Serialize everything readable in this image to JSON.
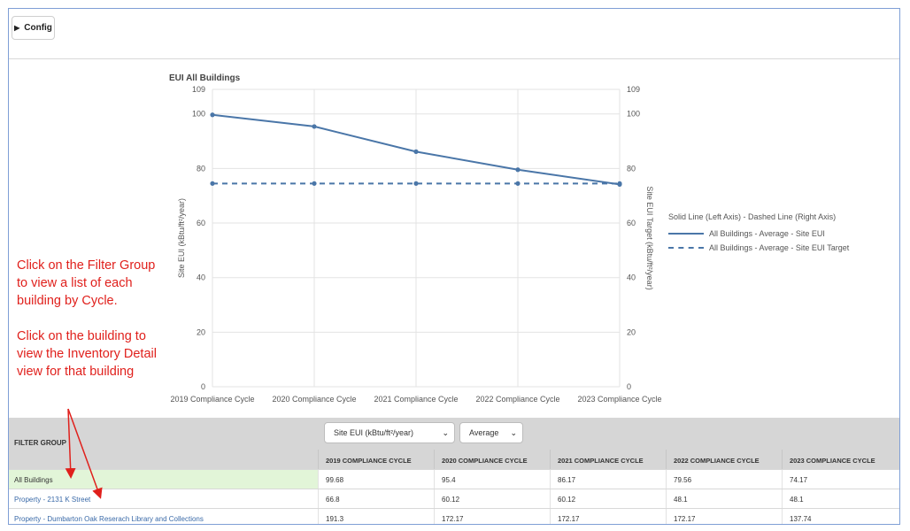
{
  "toolbar": {
    "config_label": "Config"
  },
  "chart_data": {
    "type": "line",
    "title": "EUI All Buildings",
    "categories": [
      "2019 Compliance Cycle",
      "2020 Compliance Cycle",
      "2021 Compliance Cycle",
      "2022 Compliance Cycle",
      "2023 Compliance Cycle"
    ],
    "series": [
      {
        "name": "All Buildings - Average - Site EUI",
        "values": [
          99.68,
          95.4,
          86.17,
          79.56,
          74.17
        ],
        "axis": "left",
        "style": "solid"
      },
      {
        "name": "All Buildings - Average - Site EUI Target",
        "values": [
          74.5,
          74.5,
          74.5,
          74.5,
          74.5
        ],
        "axis": "right",
        "style": "dashed"
      }
    ],
    "ylabel": "Site EUI (kBtu/ft²/year)",
    "ylabel_right": "Site EUI Target (kBtu/ft²/year)",
    "ylim": [
      0,
      109
    ],
    "yticks": [
      0,
      20,
      40,
      60,
      80,
      100,
      109
    ],
    "grid": true,
    "legend_title": "Solid Line (Left Axis) - Dashed Line (Right Axis)",
    "legend_position": "right",
    "color": "#4a76a8"
  },
  "annotation": {
    "text1": "Click on the Filter Group to view a list of each building by Cycle.",
    "text2": "Click on the building to view the Inventory Detail view for that building",
    "color": "#e0201c"
  },
  "table": {
    "filter_group_label": "FILTER GROUP",
    "metric_select": "Site EUI (kBtu/ft²/year)",
    "agg_select": "Average",
    "columns": [
      "2019 COMPLIANCE CYCLE",
      "2020 COMPLIANCE CYCLE",
      "2021 COMPLIANCE CYCLE",
      "2022 COMPLIANCE CYCLE",
      "2023 COMPLIANCE CYCLE"
    ],
    "rows": [
      {
        "name": "All Buildings",
        "values": [
          "99.68",
          "95.4",
          "86.17",
          "79.56",
          "74.17"
        ]
      },
      {
        "name": "Property - 2131 K Street",
        "values": [
          "66.8",
          "60.12",
          "60.12",
          "48.1",
          "48.1"
        ]
      },
      {
        "name": "Property - Dumbarton Oak Reserach Library and Collections",
        "values": [
          "191.3",
          "172.17",
          "172.17",
          "172.17",
          "137.74"
        ]
      }
    ]
  }
}
